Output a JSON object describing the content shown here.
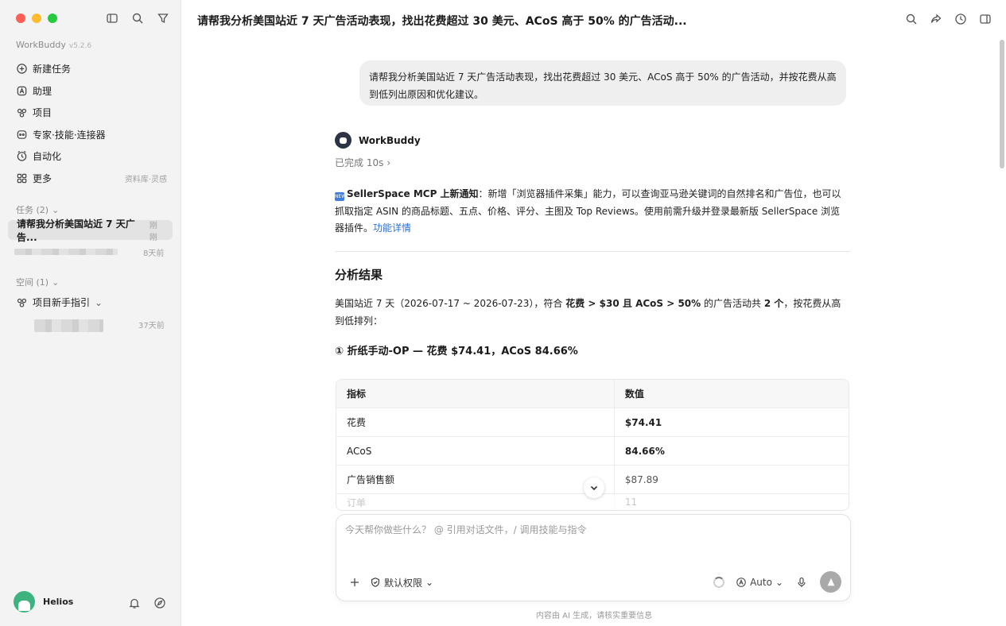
{
  "sidebar": {
    "brand": "WorkBuddy",
    "version": "v5.2.6",
    "nav": [
      {
        "label": "新建任务",
        "icon": "plus-circle-icon"
      },
      {
        "label": "助理",
        "icon": "assistant-icon"
      },
      {
        "label": "项目",
        "icon": "project-icon"
      },
      {
        "label": "专家·技能·连接器",
        "icon": "expert-icon"
      },
      {
        "label": "自动化",
        "icon": "clock-icon"
      },
      {
        "label": "更多",
        "icon": "grid-icon",
        "extra": "资料库·灵感"
      }
    ],
    "tasks_label": "任务 (2)",
    "active_task": {
      "label": "请帮我分析美国站近 7 天广告...",
      "time": "刚刚"
    },
    "other_task_time": "8天前",
    "spaces_label": "空间 (1)",
    "space_item": "项目新手指引",
    "space_task_time": "37天前",
    "user_name": "Helios"
  },
  "header": {
    "title": "请帮我分析美国站近 7 天广告活动表现，找出花费超过 30 美元、ACoS 高于 50% 的广告活动..."
  },
  "chat": {
    "user_message": "请帮我分析美国站近 7 天广告活动表现，找出花费超过 30 美元、ACoS 高于 50% 的广告活动，并按花费从高到低列出原因和优化建议。",
    "bot_name": "WorkBuddy",
    "status": "已完成 10s",
    "notice": {
      "badge": "NEW",
      "title": "SellerSpace MCP 上新通知",
      "body": "：新增「浏览器插件采集」能力，可以查询亚马逊关键词的自然排名和广告位，也可以抓取指定 ASIN 的商品标题、五点、价格、评分、主图及 Top Reviews。使用前需升级并登录最新版 SellerSpace 浏览器插件。",
      "link": "功能详情"
    },
    "result_heading": "分析结果",
    "summary": {
      "prefix": "美国站近 7 天（2026-07-17 ~ 2026-07-23），符合 ",
      "criteria": "花费 > $30 且 ACoS > 50%",
      "middle": " 的广告活动共 ",
      "count": "2 个",
      "suffix": "，按花费从高到低排列："
    },
    "campaign_title": "① 折纸手动-OP — 花费 $74.41，ACoS 84.66%",
    "table": {
      "headers": [
        "指标",
        "数值"
      ],
      "rows": [
        {
          "metric": "花费",
          "value": "$74.41"
        },
        {
          "metric": "ACoS",
          "value": "84.66%"
        },
        {
          "metric": "广告销售额",
          "value": "$87.89"
        },
        {
          "metric": "订单",
          "value": "11"
        }
      ]
    }
  },
  "composer": {
    "placeholder": "今天帮你做些什么？ @ 引用对话文件，/ 调用技能与指令",
    "permission": "默认权限",
    "model": "Auto"
  },
  "footer": "内容由 AI 生成，请核实重要信息",
  "colors": {
    "sidebar_bg": "#f3f3f3",
    "link": "#2a6fd6",
    "active_task_bg": "#e3e3e3"
  }
}
